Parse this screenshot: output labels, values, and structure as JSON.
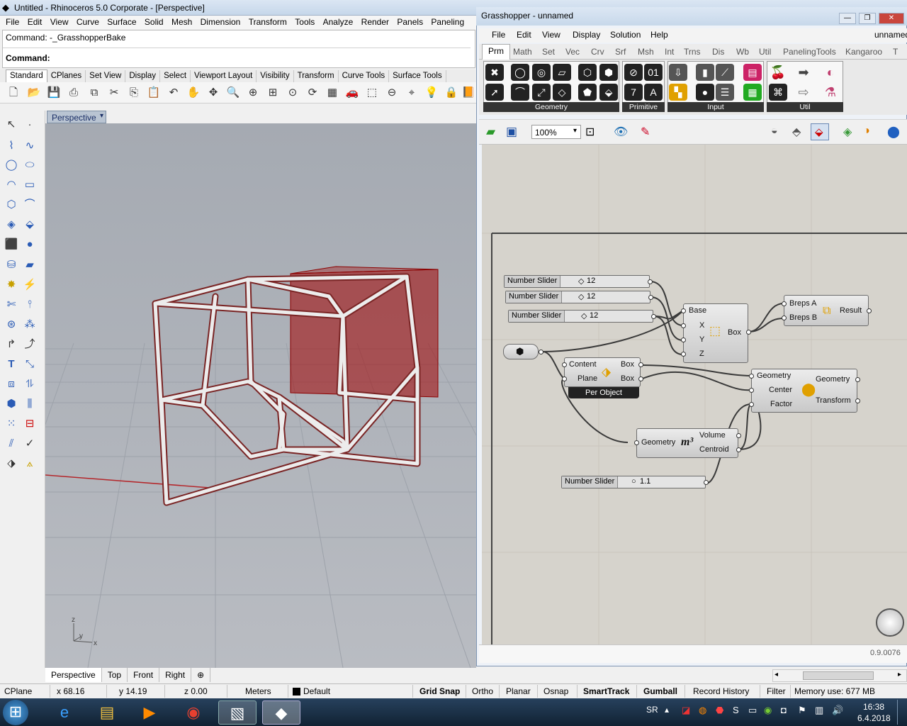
{
  "rhino": {
    "title": "Untitled - Rhinoceros  5.0 Corporate - [Perspective]",
    "menu": [
      "File",
      "Edit",
      "View",
      "Curve",
      "Surface",
      "Solid",
      "Mesh",
      "Dimension",
      "Transform",
      "Tools",
      "Analyze",
      "Render",
      "Panels",
      "Paneling"
    ],
    "command_history": "Command: -_GrasshopperBake",
    "command_prompt": "Command:",
    "tabs": [
      "Standard",
      "CPlanes",
      "Set View",
      "Display",
      "Select",
      "Viewport Layout",
      "Visibility",
      "Transform",
      "Curve Tools",
      "Surface Tools"
    ],
    "viewport_title": "Perspective",
    "viewport_tabs": [
      "Perspective",
      "Top",
      "Front",
      "Right"
    ],
    "axis_labels": {
      "z": "z",
      "y": "y",
      "x": "x"
    }
  },
  "status": {
    "cplane": "CPlane",
    "x": "x 68.16",
    "y": "y 14.19",
    "z": "z 0.00",
    "units": "Meters",
    "layer": "Default",
    "grid_snap": "Grid Snap",
    "ortho": "Ortho",
    "planar": "Planar",
    "osnap": "Osnap",
    "smarttrack": "SmartTrack",
    "gumball": "Gumball",
    "record_history": "Record History",
    "filter": "Filter",
    "memory": "Memory use: 677 MB"
  },
  "grasshopper": {
    "title": "Grasshopper - unnamed",
    "menu": [
      "File",
      "Edit",
      "View",
      "Display",
      "Solution",
      "Help"
    ],
    "doc_name": "unnamed",
    "tabs": [
      "Prm",
      "Math",
      "Set",
      "Vec",
      "Crv",
      "Srf",
      "Msh",
      "Int",
      "Trns",
      "Dis",
      "Wb",
      "Util",
      "PanelingTools",
      "Kangaroo",
      "T"
    ],
    "groups": [
      "Geometry",
      "Primitive",
      "Input",
      "Util"
    ],
    "zoom": "100%",
    "version": "0.9.0076",
    "components": {
      "slider1": {
        "label": "Number Slider",
        "value": "12"
      },
      "slider2": {
        "label": "Number Slider",
        "value": "12"
      },
      "slider3": {
        "label": "Number Slider",
        "value": "12"
      },
      "slider4": {
        "label": "Number Slider",
        "value": "1.1"
      },
      "box": {
        "in": [
          "Base",
          "X",
          "Y",
          "Z"
        ],
        "out": "Box"
      },
      "union": {
        "in": [
          "Breps A",
          "Breps B"
        ],
        "out": "Result"
      },
      "bbox": {
        "in": [
          "Content",
          "Plane"
        ],
        "out": [
          "Box",
          "Box"
        ],
        "mode": "Per Object"
      },
      "scale": {
        "in": [
          "Geometry",
          "Center",
          "Factor"
        ],
        "out": [
          "Geometry",
          "Transform"
        ]
      },
      "volume": {
        "in": "Geometry",
        "symbol": "m³",
        "out": [
          "Volume",
          "Centroid"
        ]
      }
    }
  },
  "taskbar": {
    "lang": "SR",
    "time": "16:38",
    "date": "6.4.2018"
  }
}
